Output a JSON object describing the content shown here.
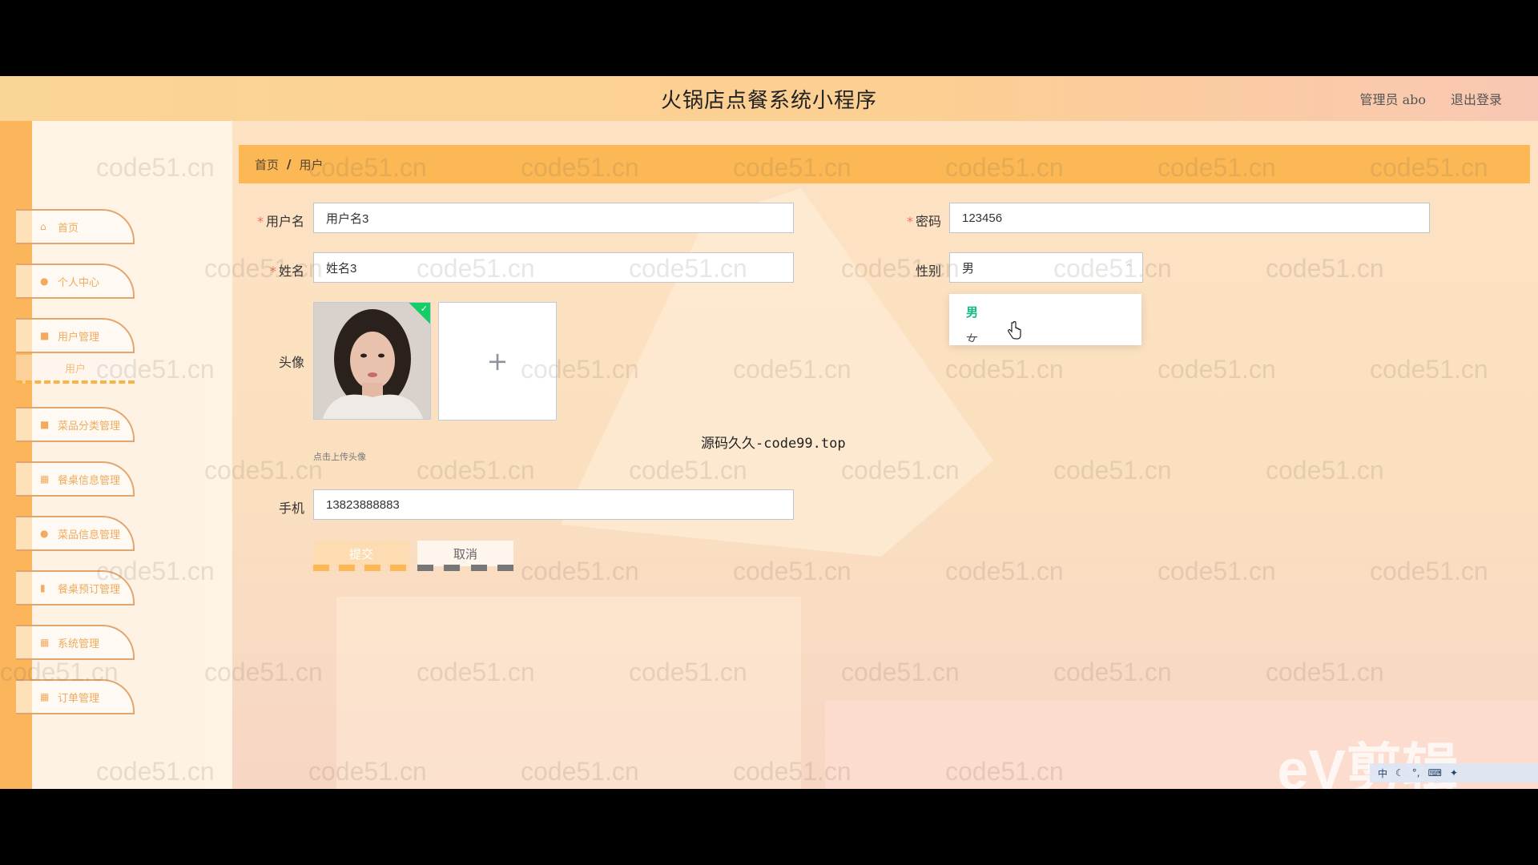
{
  "header": {
    "title": "火锅店点餐系统小程序",
    "user_label": "管理员 abo",
    "logout_label": "退出登录"
  },
  "sidebar": {
    "items": [
      {
        "label": "首页",
        "icon": "home-icon"
      },
      {
        "label": "个人中心",
        "icon": "user-icon"
      },
      {
        "label": "用户管理",
        "icon": "users-icon"
      },
      {
        "label": "菜品分类管理",
        "icon": "folder-icon"
      },
      {
        "label": "餐桌信息管理",
        "icon": "grid-icon"
      },
      {
        "label": "菜品信息管理",
        "icon": "bulb-icon"
      },
      {
        "label": "餐桌预订管理",
        "icon": "chart-icon"
      },
      {
        "label": "系统管理",
        "icon": "apps-icon"
      },
      {
        "label": "订单管理",
        "icon": "apps-icon"
      }
    ],
    "submenu_label": "用户"
  },
  "breadcrumb": {
    "home": "首页",
    "separator": "/",
    "current": "用户"
  },
  "form": {
    "username": {
      "label": "用户名",
      "value": "用户名3"
    },
    "password": {
      "label": "密码",
      "value": "123456"
    },
    "name": {
      "label": "姓名",
      "value": "姓名3"
    },
    "gender": {
      "label": "性别",
      "value": "男",
      "options": [
        "男",
        "女"
      ]
    },
    "avatar": {
      "label": "头像",
      "hint": "点击上传头像"
    },
    "phone": {
      "label": "手机",
      "value": "13823888883"
    },
    "submit_label": "提交",
    "cancel_label": "取消"
  },
  "overlay_text": "源码久久-code99.top",
  "watermark": "code51.cn",
  "video_logo": "eV剪辑",
  "colors": {
    "accent": "#fbb855",
    "selected_option": "#12b886",
    "required": "#f56c6c"
  }
}
